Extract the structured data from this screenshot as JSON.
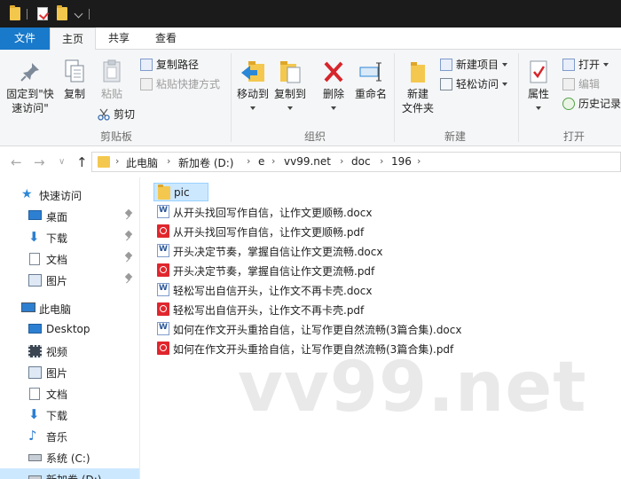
{
  "tabs": {
    "file": "文件",
    "home": "主页",
    "share": "共享",
    "view": "查看"
  },
  "ribbon": {
    "clipboard": {
      "group_label": "剪贴板",
      "pin_quick_line1": "固定到\"快",
      "pin_quick_line2": "速访问\"",
      "copy": "复制",
      "paste": "粘贴",
      "copy_path": "复制路径",
      "paste_shortcut": "粘贴快捷方式",
      "cut": "剪切"
    },
    "organize": {
      "group_label": "组织",
      "move_to": "移动到",
      "copy_to": "复制到",
      "delete": "删除",
      "rename": "重命名"
    },
    "new": {
      "group_label": "新建",
      "new_folder_line1": "新建",
      "new_folder_line2": "文件夹",
      "new_item": "新建项目",
      "easy_access": "轻松访问"
    },
    "open": {
      "group_label": "打开",
      "properties": "属性",
      "open": "打开",
      "edit": "编辑",
      "history": "历史记录"
    }
  },
  "address": {
    "breadcrumbs": [
      "此电脑",
      "新加卷 (D:)",
      "e",
      "vv99.net",
      "doc",
      "196"
    ]
  },
  "nav": {
    "quick_access": "快速访问",
    "quick_items": [
      "桌面",
      "下载",
      "文档",
      "图片"
    ],
    "this_pc": "此电脑",
    "pc_items": [
      "Desktop",
      "视频",
      "图片",
      "文档",
      "下载",
      "音乐",
      "系统 (C:)",
      "新加卷 (D:)"
    ]
  },
  "files": [
    {
      "name": "pic",
      "type": "folder"
    },
    {
      "name": "从开头找回写作自信，让作文更顺畅.docx",
      "type": "docx"
    },
    {
      "name": "从开头找回写作自信，让作文更顺畅.pdf",
      "type": "pdf"
    },
    {
      "name": "开头决定节奏，掌握自信让作文更流畅.docx",
      "type": "docx"
    },
    {
      "name": "开头决定节奏，掌握自信让作文更流畅.pdf",
      "type": "pdf"
    },
    {
      "name": "轻松写出自信开头，让作文不再卡壳.docx",
      "type": "docx"
    },
    {
      "name": "轻松写出自信开头，让作文不再卡壳.pdf",
      "type": "pdf"
    },
    {
      "name": "如何在作文开头重拾自信，让写作更自然流畅(3篇合集).docx",
      "type": "docx"
    },
    {
      "name": "如何在作文开头重拾自信，让写作更自然流畅(3篇合集).pdf",
      "type": "pdf"
    }
  ],
  "watermark": "vv99.net",
  "colors": {
    "file_tab": "#1979ca",
    "selection": "#cce8ff",
    "folder": "#f4c84f",
    "pdf": "#e0262d"
  }
}
